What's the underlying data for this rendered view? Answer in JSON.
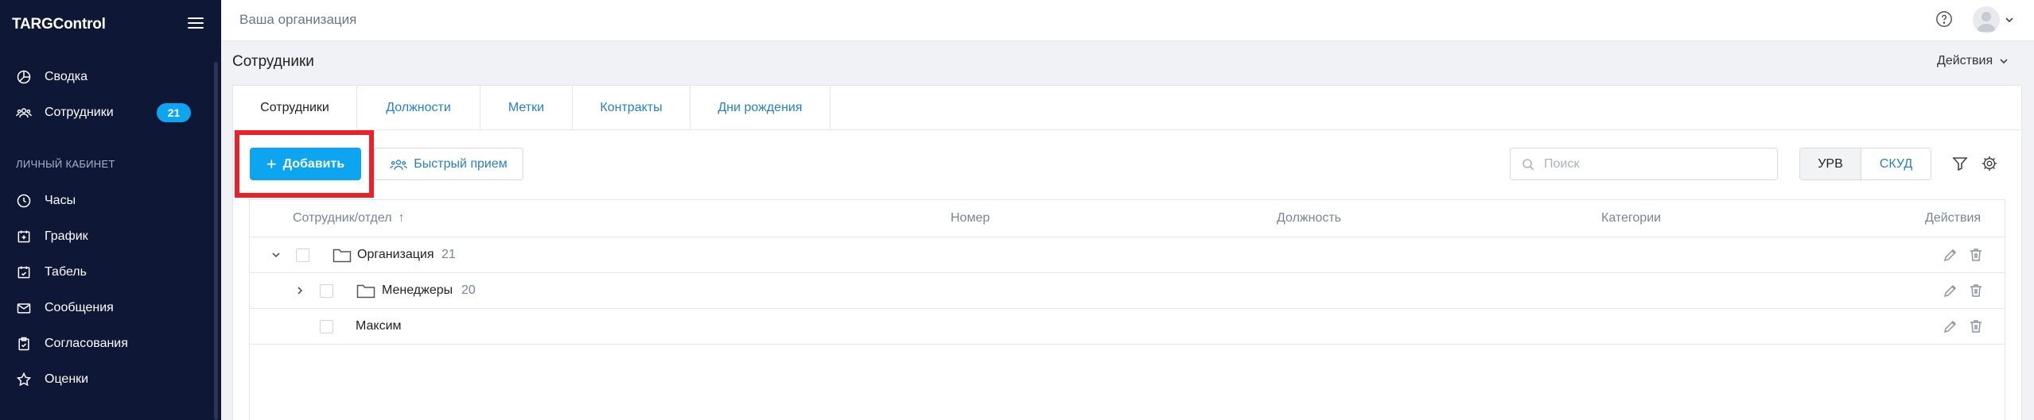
{
  "app": {
    "logo": "TARGControl"
  },
  "sidebar": {
    "items": [
      {
        "label": "Сводка",
        "icon": "chart-pie-icon"
      },
      {
        "label": "Сотрудники",
        "icon": "users-icon",
        "badge": "21",
        "active": true
      }
    ],
    "section_title": "ЛИЧНЫЙ КАБИНЕТ",
    "personal_items": [
      {
        "label": "Часы",
        "icon": "clock-icon"
      },
      {
        "label": "График",
        "icon": "calendar-plus-icon"
      },
      {
        "label": "Табель",
        "icon": "calendar-check-icon"
      },
      {
        "label": "Сообщения",
        "icon": "envelope-icon"
      },
      {
        "label": "Согласования",
        "icon": "clipboard-check-icon"
      },
      {
        "label": "Оценки",
        "icon": "star-icon"
      }
    ]
  },
  "topbar": {
    "org_name": "Ваша организация"
  },
  "page": {
    "title": "Сотрудники",
    "actions_label": "Действия"
  },
  "tabs": [
    {
      "label": "Сотрудники",
      "active": true
    },
    {
      "label": "Должности"
    },
    {
      "label": "Метки"
    },
    {
      "label": "Контракты"
    },
    {
      "label": "Дни рождения"
    }
  ],
  "toolbar": {
    "add_label": "Добавить",
    "quick_label": "Быстрый прием",
    "search_placeholder": "Поиск",
    "seg_urv": "УРВ",
    "seg_skud": "СКУД"
  },
  "table": {
    "columns": {
      "employee": "Сотрудник/отдел",
      "number": "Номер",
      "position": "Должность",
      "categories": "Категории",
      "actions": "Действия"
    },
    "rows": [
      {
        "name": "Организация",
        "count": "21",
        "type": "folder",
        "expanded": true,
        "level": 0
      },
      {
        "name": "Менеджеры",
        "count": "20",
        "type": "folder",
        "expanded": false,
        "level": 1
      },
      {
        "name": "Максим",
        "type": "employee",
        "level": 1
      }
    ]
  },
  "colors": {
    "sidebar_bg": "#0e1736",
    "accent": "#0ea5f0",
    "link": "#2b7fbf",
    "highlight": "#e8212b"
  }
}
